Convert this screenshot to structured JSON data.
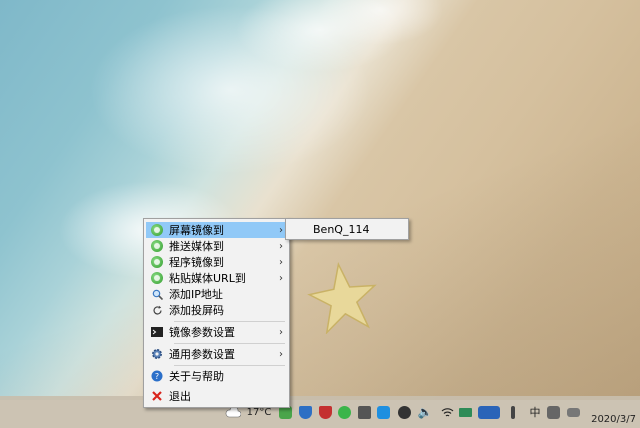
{
  "context_menu": {
    "items": [
      {
        "label": "屏幕镜像到",
        "icon": "green-mirror-icon",
        "submenu": true,
        "highlighted": true
      },
      {
        "label": "推送媒体到",
        "icon": "green-mirror-icon",
        "submenu": true
      },
      {
        "label": "程序镜像到",
        "icon": "green-mirror-icon",
        "submenu": true
      },
      {
        "label": "粘贴媒体URL到",
        "icon": "green-mirror-icon",
        "submenu": true
      },
      {
        "label": "添加IP地址",
        "icon": "search-icon",
        "submenu": false
      },
      {
        "label": "添加投屏码",
        "icon": "refresh-icon",
        "submenu": false
      },
      {
        "label": "镜像参数设置",
        "icon": "terminal-icon",
        "submenu": true
      },
      {
        "label": "通用参数设置",
        "icon": "gear-icon",
        "submenu": true
      },
      {
        "label": "关于与帮助",
        "icon": "help-icon",
        "submenu": false
      },
      {
        "label": "退出",
        "icon": "close-icon",
        "submenu": false
      }
    ],
    "arrow": "›"
  },
  "submenu": {
    "items": [
      {
        "label": "BenQ_114"
      }
    ]
  },
  "taskbar": {
    "weather": "17°C",
    "input_method": "中",
    "date": "2020/3/7"
  },
  "colors": {
    "highlight": "#91c9f7",
    "menu_bg": "#f2f2f2",
    "exit_red": "#d9241c"
  }
}
